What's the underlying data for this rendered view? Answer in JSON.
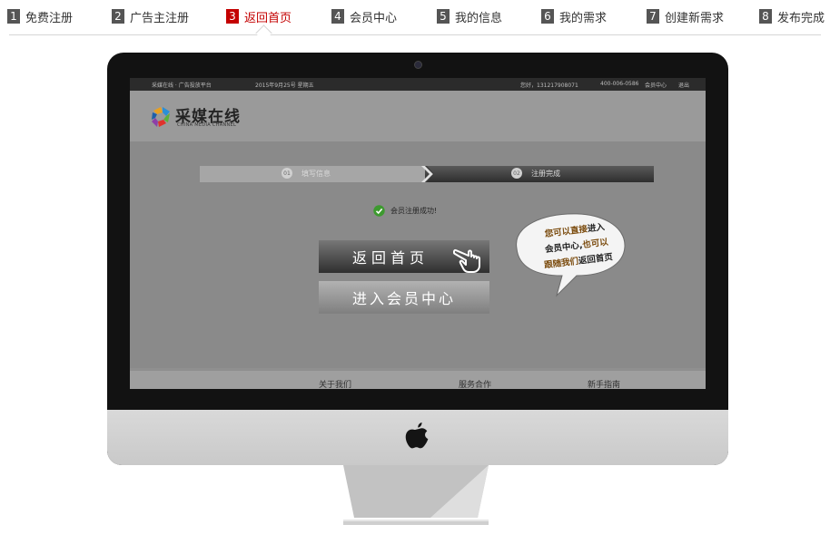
{
  "steps": [
    {
      "num": "1",
      "label": "免费注册"
    },
    {
      "num": "2",
      "label": "广告主注册"
    },
    {
      "num": "3",
      "label": "返回首页"
    },
    {
      "num": "4",
      "label": "会员中心"
    },
    {
      "num": "5",
      "label": "我的信息"
    },
    {
      "num": "6",
      "label": "我的需求"
    },
    {
      "num": "7",
      "label": "创建新需求"
    },
    {
      "num": "8",
      "label": "发布完成"
    }
  ],
  "active_step": "3",
  "colors": {
    "active": "#c40000",
    "step_badge": "#555555"
  },
  "screen": {
    "topbar": {
      "site": "采媒在线 · 广告投放平台",
      "date": "2015年9月25号 星期五",
      "greeting": "您好，131217908071",
      "phone": "400-006-0586",
      "member": "会员中心",
      "logout": "退出"
    },
    "logo": {
      "name": "采媒在线",
      "sub": "CHINA MEDIA CHANNEL"
    },
    "progress": {
      "step1_num": "01",
      "step1_label": "填写信息",
      "step2_num": "02",
      "step2_label": "注册完成"
    },
    "success_msg": "会员注册成功!",
    "buttons": {
      "home": "返回首页",
      "member": "进入会员中心"
    },
    "bubble": {
      "line1_a": "您可以直接",
      "line1_b": "进入",
      "line2_a": "会员中心,",
      "line2_b": "也可以",
      "line3_a": "跟随我们",
      "line3_b": "返回首页"
    },
    "footer": {
      "about": "关于我们",
      "service": "服务合作",
      "guide": "新手指南"
    }
  }
}
